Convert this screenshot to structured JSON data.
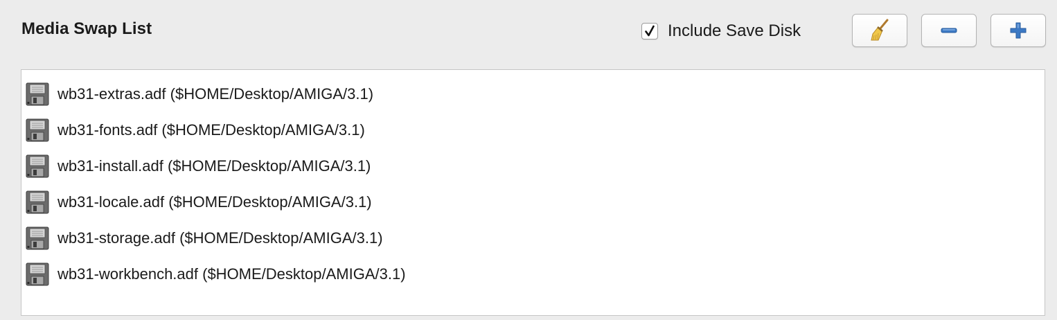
{
  "panel": {
    "title": "Media Swap List"
  },
  "include_save_disk": {
    "label": "Include Save Disk",
    "checked": true
  },
  "toolbar": {
    "clear_icon": "broom-icon",
    "remove_icon": "minus-icon",
    "add_icon": "plus-icon",
    "accent_color": "#3c79c4"
  },
  "media_list": {
    "item_icon": "floppy-disk-icon",
    "items": [
      {
        "label": "wb31-extras.adf ($HOME/Desktop/AMIGA/3.1)"
      },
      {
        "label": "wb31-fonts.adf ($HOME/Desktop/AMIGA/3.1)"
      },
      {
        "label": "wb31-install.adf ($HOME/Desktop/AMIGA/3.1)"
      },
      {
        "label": "wb31-locale.adf ($HOME/Desktop/AMIGA/3.1)"
      },
      {
        "label": "wb31-storage.adf ($HOME/Desktop/AMIGA/3.1)"
      },
      {
        "label": "wb31-workbench.adf ($HOME/Desktop/AMIGA/3.1)"
      }
    ]
  }
}
